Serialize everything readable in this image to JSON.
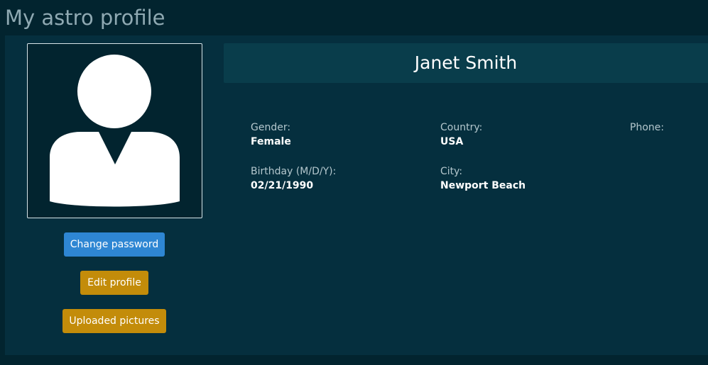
{
  "page": {
    "title": "My astro profile"
  },
  "profile": {
    "name": "Janet Smith",
    "avatar_icon": "user-silhouette-icon"
  },
  "buttons": {
    "change_password": "Change password",
    "edit_profile": "Edit profile",
    "uploaded_pictures": "Uploaded pictures"
  },
  "fields": {
    "gender": {
      "label": "Gender:",
      "value": "Female"
    },
    "country": {
      "label": "Country:",
      "value": "USA"
    },
    "phone": {
      "label": "Phone:",
      "value": ""
    },
    "birthday": {
      "label": "Birthday (M/D/Y):",
      "value": "02/21/1990"
    },
    "city": {
      "label": "City:",
      "value": "Newport Beach"
    }
  },
  "colors": {
    "background": "#02242f",
    "panel": "#052f3e",
    "name_bar": "#093d4b",
    "primary_button": "#2e86d3",
    "warning_button": "#c38c0a",
    "title_text": "#8fa9b2"
  }
}
